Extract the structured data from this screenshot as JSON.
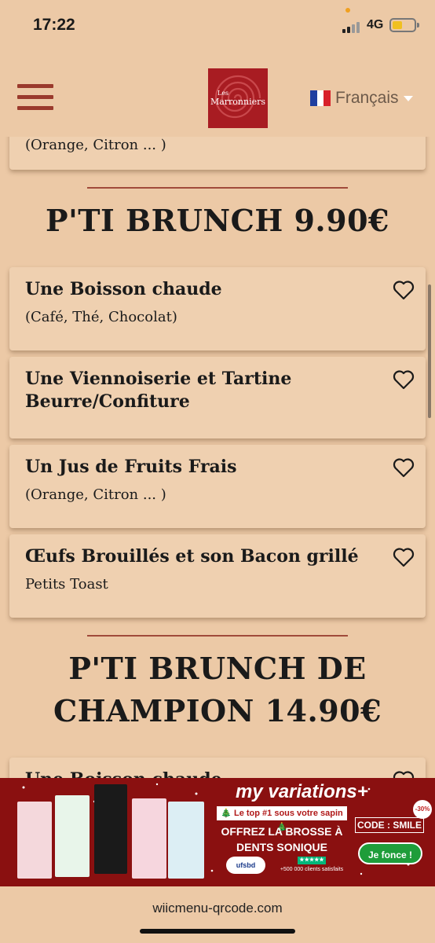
{
  "status": {
    "time": "17:22",
    "network": "4G"
  },
  "header": {
    "logo_line1": "Les",
    "logo_line2": "Marronniers",
    "language": "Français"
  },
  "top_partial_card": {
    "desc": "(Orange, Citron ... )"
  },
  "sections": [
    {
      "title": "P'TI BRUNCH 9.90€",
      "items": [
        {
          "title": "Une Boisson chaude",
          "desc": "(Café, Thé, Chocolat)"
        },
        {
          "title": "Une Viennoiserie et Tartine Beurre/Confiture",
          "desc": ""
        },
        {
          "title": "Un Jus de Fruits Frais",
          "desc": "(Orange, Citron ... )"
        },
        {
          "title": "Œufs Brouillés et son Bacon grillé",
          "desc": "Petits Toast"
        }
      ]
    },
    {
      "title_line1": "P'TI BRUNCH DE",
      "title_line2": "CHAMPION 14.90€",
      "items": [
        {
          "title": "Une Boisson chaude",
          "desc": ""
        }
      ]
    }
  ],
  "ad": {
    "brand": "my variations+",
    "top_banner": "🎄 Le top #1 sous votre sapin 🎄",
    "headline_1": "OFFREZ LA BROSSE À",
    "headline_2": "DENTS SONIQUE",
    "code": "CODE : SMILE",
    "cta": "Je fonce !",
    "badge": "-30%",
    "ufsbd": "ufsbd",
    "trust": "+500 000 clients satisfaits"
  },
  "url": "wiicmenu-qrcode.com",
  "colors": {
    "background": "#ecc9a6",
    "card": "#efd0b0",
    "accent": "#a04a3a",
    "ad_bg": "#8a1010"
  }
}
